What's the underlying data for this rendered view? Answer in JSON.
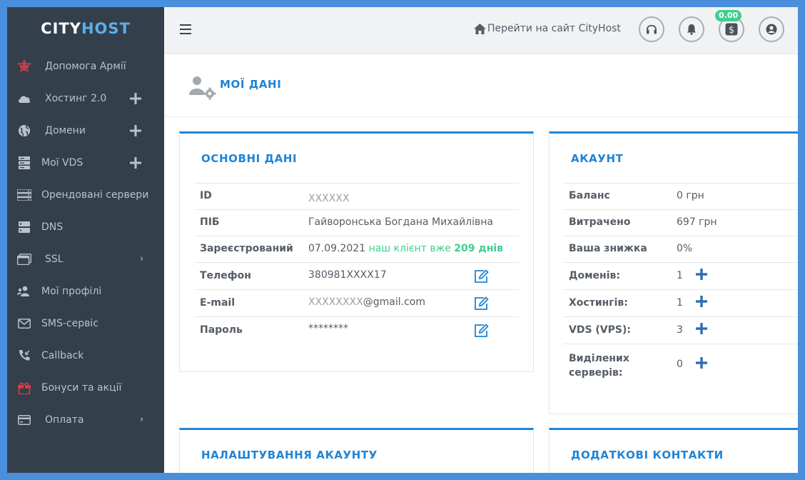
{
  "brand": {
    "part1": "CITY",
    "part2": "HOST"
  },
  "sidebar": {
    "items": [
      {
        "label": "Допомога Армії",
        "icon": "army-emblem-icon"
      },
      {
        "label": "Хостинг 2.0",
        "icon": "cloud-icon",
        "expand": "plus"
      },
      {
        "label": "Домени",
        "icon": "globe-icon",
        "expand": "plus"
      },
      {
        "label": "Мої VDS",
        "icon": "server-stack-icon",
        "expand": "plus"
      },
      {
        "label": "Орендовані сервери",
        "icon": "rack-server-icon"
      },
      {
        "label": "DNS",
        "icon": "dns-server-icon"
      },
      {
        "label": "SSL",
        "icon": "ssl-window-icon",
        "expand": "chevron"
      },
      {
        "label": "Мої профілі",
        "icon": "users-gear-icon"
      },
      {
        "label": "SMS-сервіс",
        "icon": "envelope-icon"
      },
      {
        "label": "Callback",
        "icon": "phone-callback-icon"
      },
      {
        "label": "Бонуси та акції",
        "icon": "gift-icon"
      },
      {
        "label": "Оплата",
        "icon": "credit-card-icon",
        "expand": "chevron"
      }
    ]
  },
  "topbar": {
    "site_link": "Перейти на сайт CityHost",
    "balance_badge": "0.00",
    "icons": [
      "headset-icon",
      "bell-icon",
      "dollar-icon",
      "user-circle-icon"
    ]
  },
  "page": {
    "title": "МОЇ ДАНІ"
  },
  "basic": {
    "title": "ОСНОВНІ ДАНІ",
    "id_label": "ID",
    "id_value": "XXXXXX",
    "name_label": "ПІБ",
    "name_value": "Гайворонська Богдана Михайлівна",
    "reg_label": "Зареєстрований",
    "reg_date": "07.09.2021",
    "reg_text": "наш клієнт вже",
    "reg_days": "209 днів",
    "phone_label": "Телефон",
    "phone_value": "380981XXXX17",
    "email_label": "E-mail",
    "email_masked": "XXXXXXXX",
    "email_domain": "@gmail.com",
    "password_label": "Пароль",
    "password_value": "********"
  },
  "account": {
    "title": "АКАУНТ",
    "balance_label": "Баланс",
    "balance_value": "0 грн",
    "spent_label": "Витрачено",
    "spent_value": "697 грн",
    "discount_label": "Ваша знижка",
    "discount_value": "0%",
    "domains_label": "Доменів:",
    "domains_value": "1",
    "hostings_label": "Хостингів:",
    "hostings_value": "1",
    "vds_label": "VDS (VPS):",
    "vds_value": "3",
    "dedicated_label_1": "Виділених",
    "dedicated_label_2": "серверів:",
    "dedicated_value": "0"
  },
  "settings": {
    "title": "НАЛАШТУВАННЯ АКАУНТУ"
  },
  "contacts": {
    "title": "ДОДАТКОВІ КОНТАКТИ"
  },
  "colors": {
    "accent": "#1f84d6",
    "sidebar": "#343f4c",
    "success": "#3ecf8e",
    "frame": "#4a8fdc"
  }
}
